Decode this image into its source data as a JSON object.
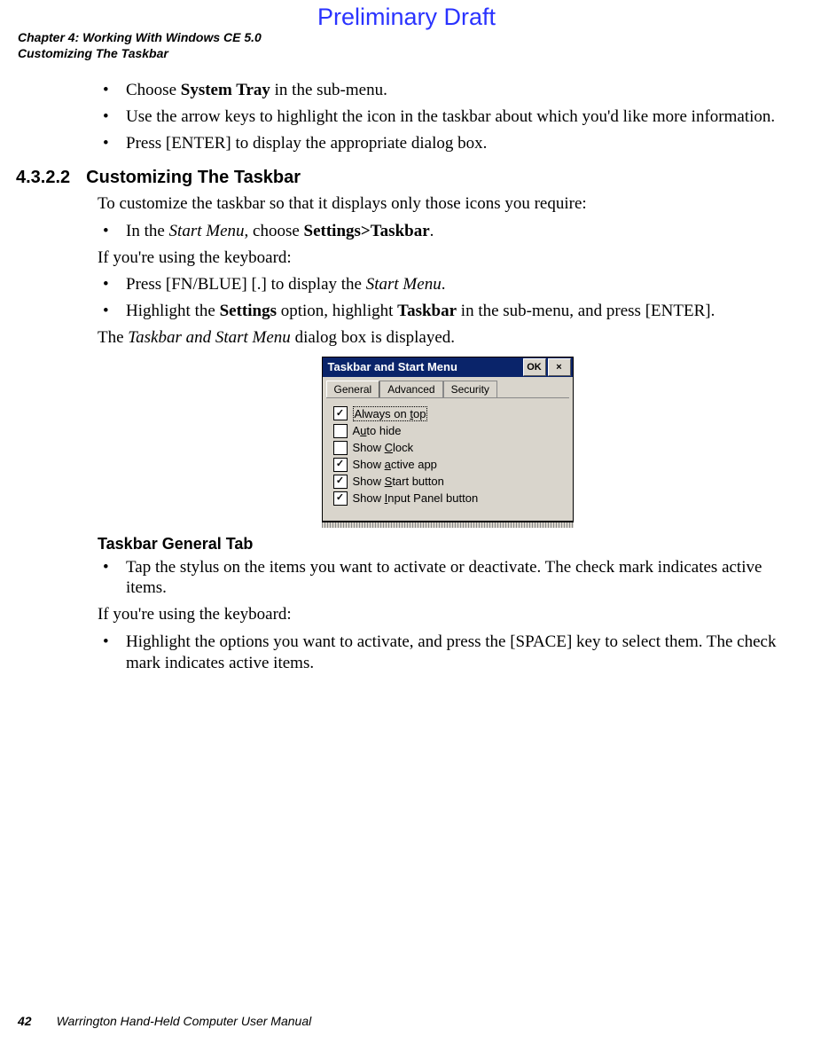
{
  "watermark": "Preliminary Draft",
  "header": {
    "chapter": "Chapter 4:  Working With Windows CE 5.0",
    "section": "Customizing The Taskbar"
  },
  "bullets_top": [
    {
      "pre": "Choose ",
      "bold": "System Tray",
      "post": " in the sub-menu."
    },
    {
      "pre": "Use the arrow keys to highlight the icon in the taskbar about which you'd like more information."
    },
    {
      "pre": "Press [ENTER] to display the appropriate dialog box."
    }
  ],
  "sec": {
    "num": "4.3.2.2",
    "title": "Customizing The Taskbar"
  },
  "intro": "To customize the taskbar so that it displays only those icons you require:",
  "start_bullet": {
    "pre": "In the ",
    "ital": "Start Menu",
    "mid": ", choose ",
    "bold": "Settings>Taskbar",
    "post": "."
  },
  "kb_intro": "If you're using the keyboard:",
  "kb_bullets": [
    {
      "pre": "Press [FN/BLUE] [.] to display the ",
      "ital": "Start Menu",
      "post": "."
    },
    {
      "pre": "Highlight the ",
      "bold1": "Settings",
      "mid": " option, highlight ",
      "bold2": "Taskbar",
      "post": " in the sub-menu, and press [ENTER]."
    }
  ],
  "dialog_intro": {
    "pre": "The ",
    "ital": "Taskbar and Start Menu",
    "post": " dialog box is displayed."
  },
  "dialog": {
    "title": "Taskbar and Start Menu",
    "ok": "OK",
    "tabs": [
      "General",
      "Advanced",
      "Security"
    ],
    "options": [
      {
        "checked": true,
        "label_pre": "Always on ",
        "u": "t",
        "label_post": "op"
      },
      {
        "checked": false,
        "label_pre": "A",
        "u": "u",
        "label_post": "to hide"
      },
      {
        "checked": false,
        "label_pre": "Show ",
        "u": "C",
        "label_post": "lock"
      },
      {
        "checked": true,
        "label_pre": "Show ",
        "u": "a",
        "label_post": "ctive app"
      },
      {
        "checked": true,
        "label_pre": "Show ",
        "u": "S",
        "label_post": "tart button"
      },
      {
        "checked": true,
        "label_pre": "Show ",
        "u": "I",
        "label_post": "nput Panel button"
      }
    ]
  },
  "subhead": "Taskbar General Tab",
  "stylus_bullet": "Tap the stylus on the items you want to activate or deactivate. The check mark indicates active items.",
  "kb2_intro": "If you're using the keyboard:",
  "kb2_bullet": "Highlight the options you want to activate, and press the [SPACE] key to select them. The check mark indicates active items.",
  "footer": {
    "page": "42",
    "title": "Warrington Hand-Held Computer User Manual"
  }
}
